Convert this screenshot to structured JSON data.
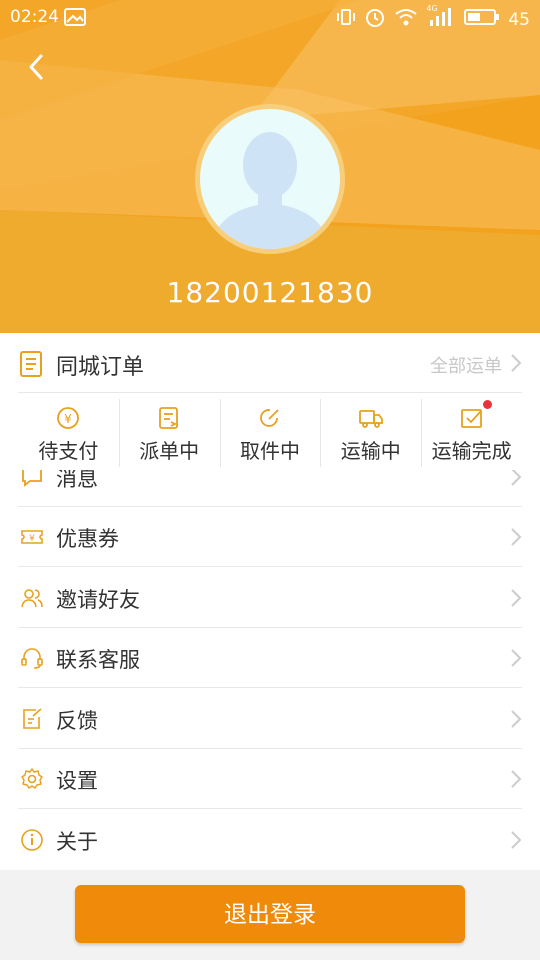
{
  "status_bar": {
    "time": "02:24",
    "network": "4G",
    "battery": "45"
  },
  "profile": {
    "phone": "18200121830"
  },
  "orders": {
    "title": "同城订单",
    "view_all": "全部运单",
    "statuses": [
      {
        "label": "待支付",
        "icon": "wallet-yuan-icon"
      },
      {
        "label": "派单中",
        "icon": "dispatch-doc-icon"
      },
      {
        "label": "取件中",
        "icon": "pickup-edit-icon"
      },
      {
        "label": "运输中",
        "icon": "truck-icon"
      },
      {
        "label": "运输完成",
        "icon": "check-box-icon",
        "has_badge": true
      }
    ]
  },
  "menu": {
    "items": [
      {
        "label": "消息",
        "icon": "message-icon"
      },
      {
        "label": "优惠券",
        "icon": "coupon-icon"
      },
      {
        "label": "邀请好友",
        "icon": "invite-friends-icon"
      },
      {
        "label": "联系客服",
        "icon": "headset-icon"
      },
      {
        "label": "反馈",
        "icon": "feedback-icon"
      },
      {
        "label": "设置",
        "icon": "settings-gear-icon"
      },
      {
        "label": "关于",
        "icon": "info-icon"
      }
    ]
  },
  "logout": {
    "label": "退出登录"
  },
  "colors": {
    "accent": "#f2a21c",
    "icon": "#e7a11f",
    "button": "#f08a0a",
    "badge": "#e8333b"
  }
}
